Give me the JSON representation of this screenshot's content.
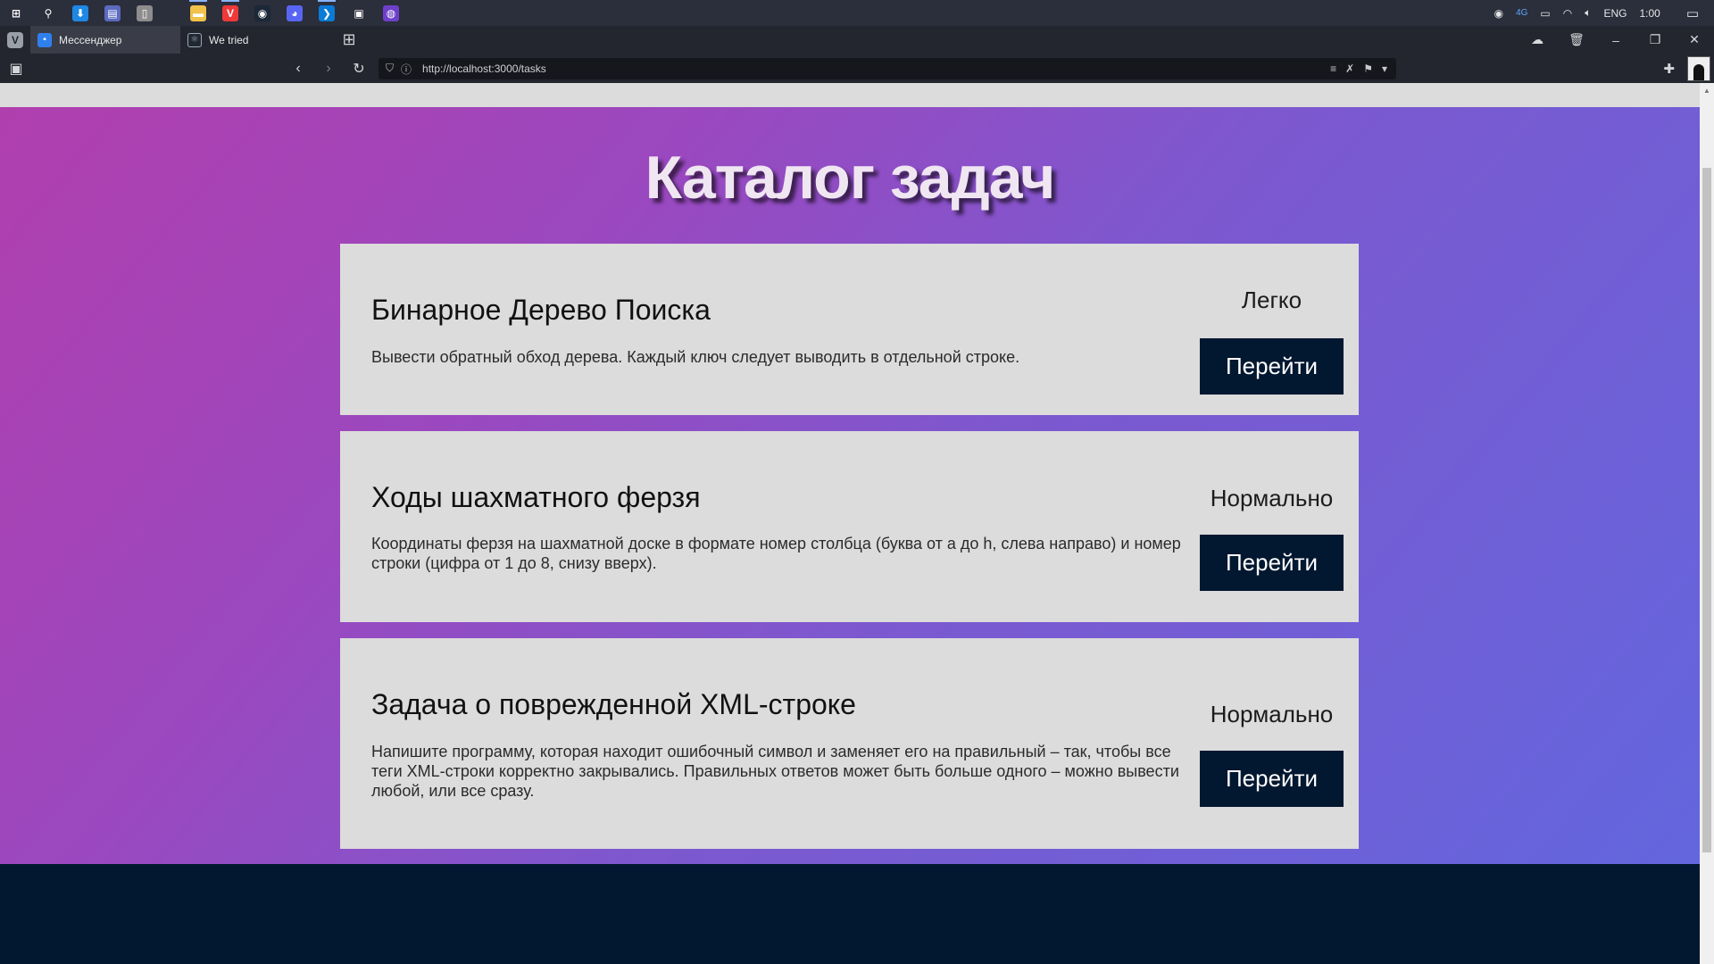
{
  "taskbar": {
    "pinned": [
      {
        "name": "windows-start-icon",
        "glyph": "⊞",
        "color": "#2b2e3b"
      },
      {
        "name": "search-icon",
        "glyph": "⚲",
        "color": "#2b2e3b"
      },
      {
        "name": "download-icon",
        "glyph": "⬇",
        "color": "#1e88e5"
      },
      {
        "name": "notepad-icon",
        "glyph": "▤",
        "color": "#5c6bc0"
      },
      {
        "name": "document-icon",
        "glyph": "▯",
        "color": "#8d8d8d"
      },
      {
        "name": "file-explorer-icon",
        "glyph": "▬",
        "color": "#f0c24b"
      },
      {
        "name": "vivaldi-icon",
        "glyph": "V",
        "color": "#ef3939"
      },
      {
        "name": "steam-icon",
        "glyph": "◉",
        "color": "#1b2838"
      },
      {
        "name": "discord-icon",
        "glyph": "◕",
        "color": "#5865f2"
      },
      {
        "name": "vscode-icon",
        "glyph": "❯",
        "color": "#0a7bd6"
      },
      {
        "name": "twitch-icon",
        "glyph": "▣",
        "color": "#2b2e3b"
      },
      {
        "name": "github-icon",
        "glyph": "◍",
        "color": "#6e40c9"
      }
    ],
    "tray": {
      "language": "ENG",
      "time": "1:00",
      "network_badge": "4G"
    }
  },
  "browser": {
    "tabs": [
      {
        "label": "Мессенджер",
        "active": true
      },
      {
        "label": "We tried",
        "active": false
      }
    ],
    "url": "http://localhost:3000/tasks"
  },
  "page": {
    "title": "Каталог задач",
    "tasks": [
      {
        "title": "Бинарное Дерево Поиска",
        "description": "Вывести обратный обход дерева. Каждый ключ следует выводить в отдельной строке.",
        "difficulty": "Легко",
        "button": "Перейти"
      },
      {
        "title": "Ходы шахматного ферзя",
        "description": "Координаты ферзя на шахматной доске в формате номер столбца (буква от a до h, слева направо) и номер строки (цифра от 1 до 8, снизу вверх).",
        "difficulty": "Нормально",
        "button": "Перейти"
      },
      {
        "title": "Задача о поврежденной XML-строке",
        "description": "Напишите программу, которая находит ошибочный символ и заменяет его на правильный – так, чтобы все теги XML-строки корректно закрывались. Правильных ответов может быть больше одного – можно вывести любой, или все сразу.",
        "difficulty": "Нормально",
        "button": "Перейти"
      }
    ]
  },
  "colors": {
    "gradient_start": "#b13fae",
    "gradient_end": "#6366dd",
    "button_bg": "#021730",
    "card_bg": "#dcdcdc"
  }
}
